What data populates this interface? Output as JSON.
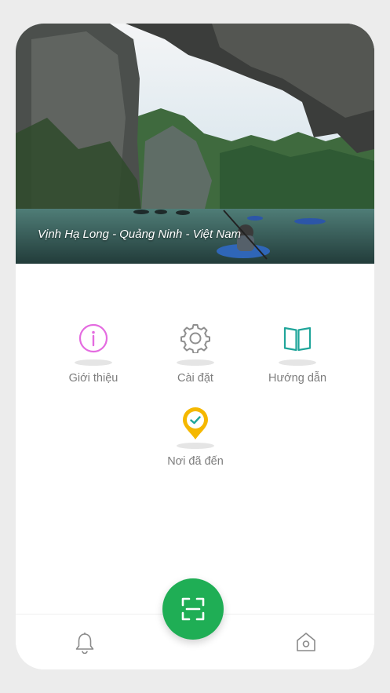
{
  "hero": {
    "caption": "Vịnh Hạ Long - Quảng Ninh - Việt Nam"
  },
  "menu": [
    {
      "label": "Giới thiệu",
      "icon": "info-icon",
      "color": "#e46be0"
    },
    {
      "label": "Cài đặt",
      "icon": "gear-icon",
      "color": "#8f8f8f"
    },
    {
      "label": "Hướng dẫn",
      "icon": "book-icon",
      "color": "#1fa59a"
    },
    {
      "label": "Nơi đã đến",
      "icon": "location-check-icon",
      "color": "#f5b800"
    }
  ],
  "bottom_nav": {
    "left_icon": "bell-icon",
    "center_icon": "scan-icon",
    "right_icon": "home-icon",
    "accent": "#1fae55"
  }
}
